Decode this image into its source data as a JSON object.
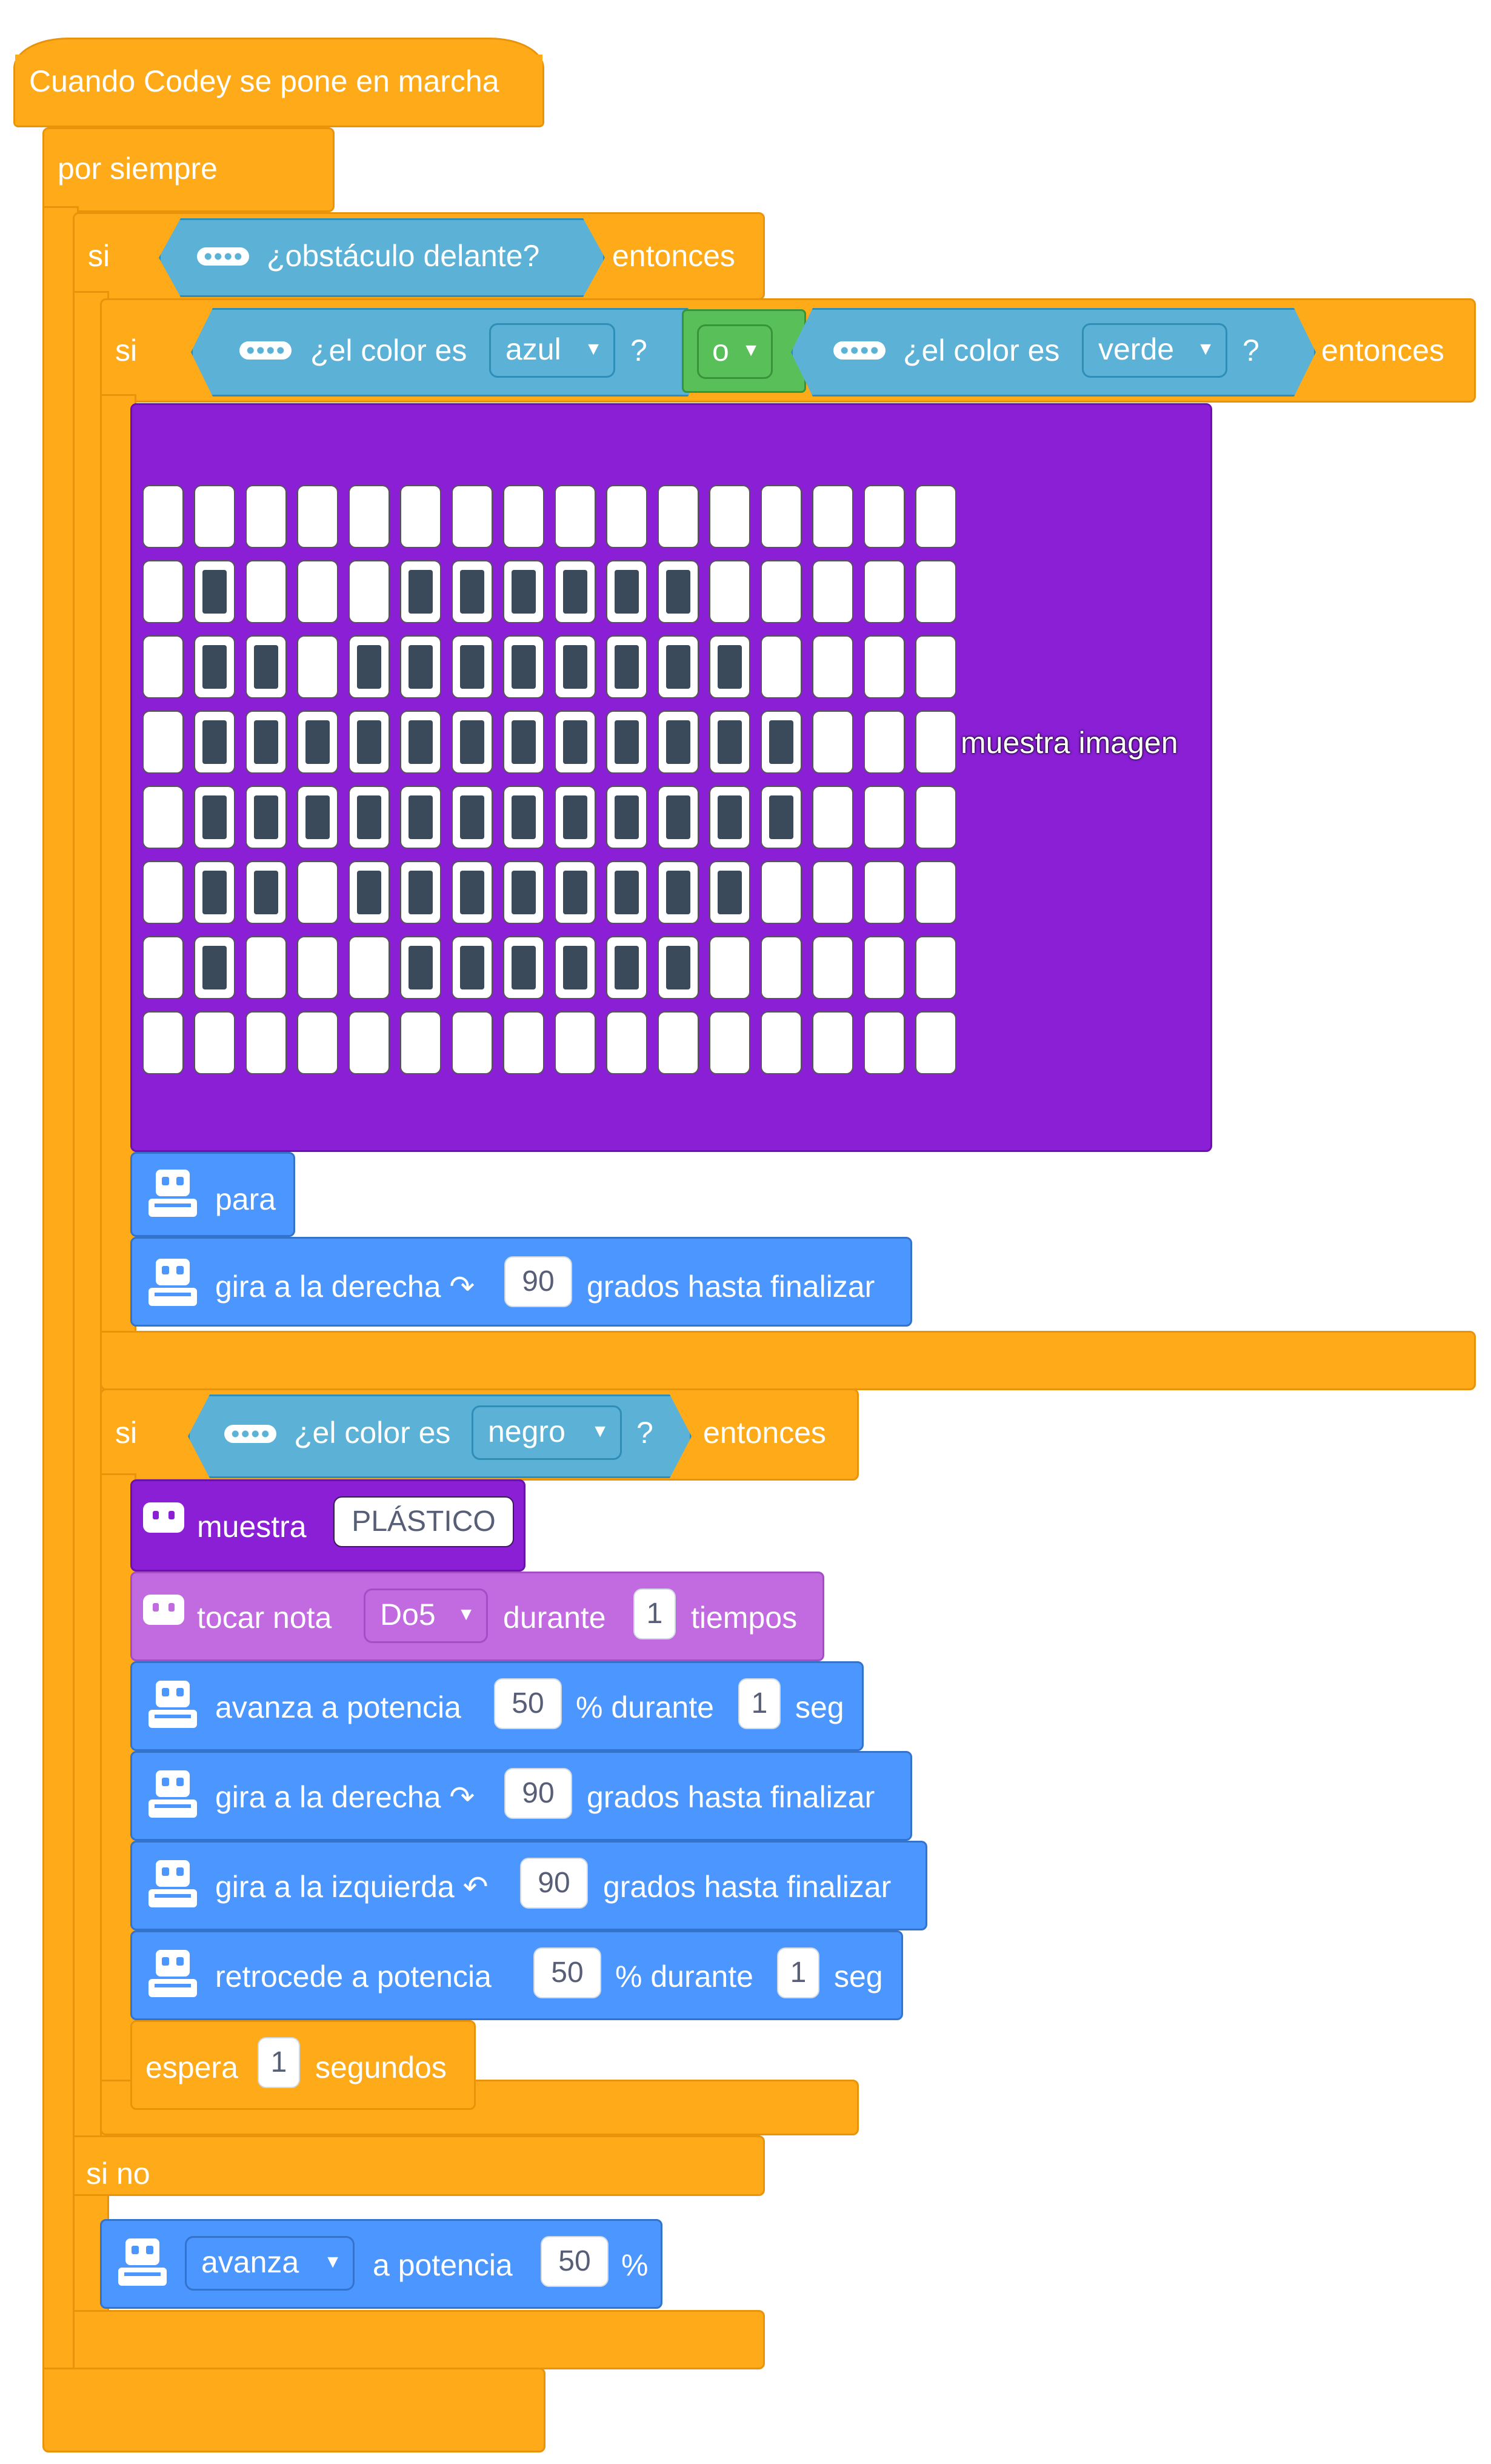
{
  "hat_label": "Cuando Codey se pone en marcha",
  "forever_label": "por siempre",
  "if1": {
    "si": "si",
    "cond": "¿obstáculo delante?",
    "then": "entonces"
  },
  "if2": {
    "si": "si",
    "cond_a": "¿el color es",
    "color_a": "azul",
    "q": "?",
    "or": "o",
    "cond_b": "¿el color es",
    "color_b": "verde",
    "then": "entonces"
  },
  "image_block": {
    "label": "muestra imagen",
    "grid": [
      [
        0,
        0,
        0,
        0,
        0,
        0,
        0,
        0,
        0,
        0,
        0,
        0,
        0,
        0,
        0,
        0
      ],
      [
        0,
        1,
        0,
        0,
        0,
        1,
        1,
        1,
        1,
        1,
        1,
        0,
        0,
        0,
        0,
        0
      ],
      [
        0,
        1,
        1,
        0,
        1,
        1,
        1,
        1,
        1,
        1,
        1,
        1,
        0,
        0,
        0,
        0
      ],
      [
        0,
        1,
        1,
        1,
        1,
        1,
        1,
        1,
        1,
        1,
        1,
        1,
        1,
        0,
        0,
        0
      ],
      [
        0,
        1,
        1,
        1,
        1,
        1,
        1,
        1,
        1,
        1,
        1,
        1,
        1,
        0,
        0,
        0
      ],
      [
        0,
        1,
        1,
        0,
        1,
        1,
        1,
        1,
        1,
        1,
        1,
        1,
        0,
        0,
        0,
        0
      ],
      [
        0,
        1,
        0,
        0,
        0,
        1,
        1,
        1,
        1,
        1,
        1,
        0,
        0,
        0,
        0,
        0
      ],
      [
        0,
        0,
        0,
        0,
        0,
        0,
        0,
        0,
        0,
        0,
        0,
        0,
        0,
        0,
        0,
        0
      ]
    ]
  },
  "stop_label": "para",
  "turn_right_1": {
    "label": "gira a la derecha ↷",
    "value": "90",
    "suffix": "grados hasta finalizar"
  },
  "if3": {
    "si": "si",
    "cond": "¿el color es",
    "color": "negro",
    "q": "?",
    "then": "entonces"
  },
  "show_text": {
    "label": "muestra",
    "value": "PLÁSTICO"
  },
  "play_note": {
    "label": "tocar nota",
    "note": "Do5",
    "mid": "durante",
    "beats": "1",
    "suffix": "tiempos"
  },
  "forward": {
    "label": "avanza a potencia",
    "power": "50",
    "mid": "% durante",
    "secs": "1",
    "suffix": "seg"
  },
  "turn_right_2": {
    "label": "gira a la derecha ↷",
    "value": "90",
    "suffix": "grados hasta finalizar"
  },
  "turn_left": {
    "label": "gira a la izquierda ↶",
    "value": "90",
    "suffix": "grados hasta finalizar"
  },
  "backward": {
    "label": "retrocede a potencia",
    "power": "50",
    "mid": "% durante",
    "secs": "1",
    "suffix": "seg"
  },
  "wait": {
    "label": "espera",
    "value": "1",
    "suffix": "segundos"
  },
  "else_label": "si no",
  "move": {
    "direction": "avanza",
    "mid": "a potencia",
    "power": "50",
    "suffix": "%"
  },
  "colors": {
    "events": "#ffab19",
    "motion": "#4c97ff",
    "looks": "#8a1fd6",
    "sound": "#c26be0",
    "sensing": "#5cb1d6",
    "operator": "#59c059"
  }
}
